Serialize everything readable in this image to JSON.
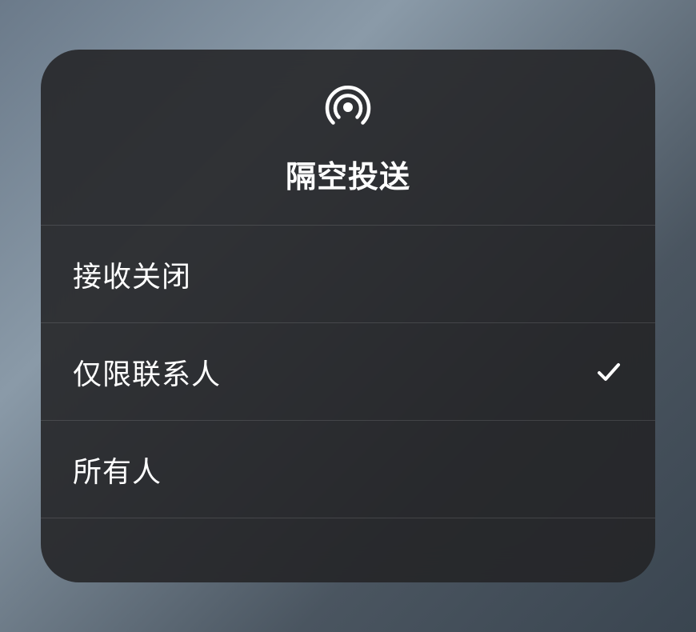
{
  "panel": {
    "title": "隔空投送",
    "icon": "airdrop-icon",
    "options": [
      {
        "label": "接收关闭",
        "selected": false
      },
      {
        "label": "仅限联系人",
        "selected": true
      },
      {
        "label": "所有人",
        "selected": false
      }
    ]
  }
}
